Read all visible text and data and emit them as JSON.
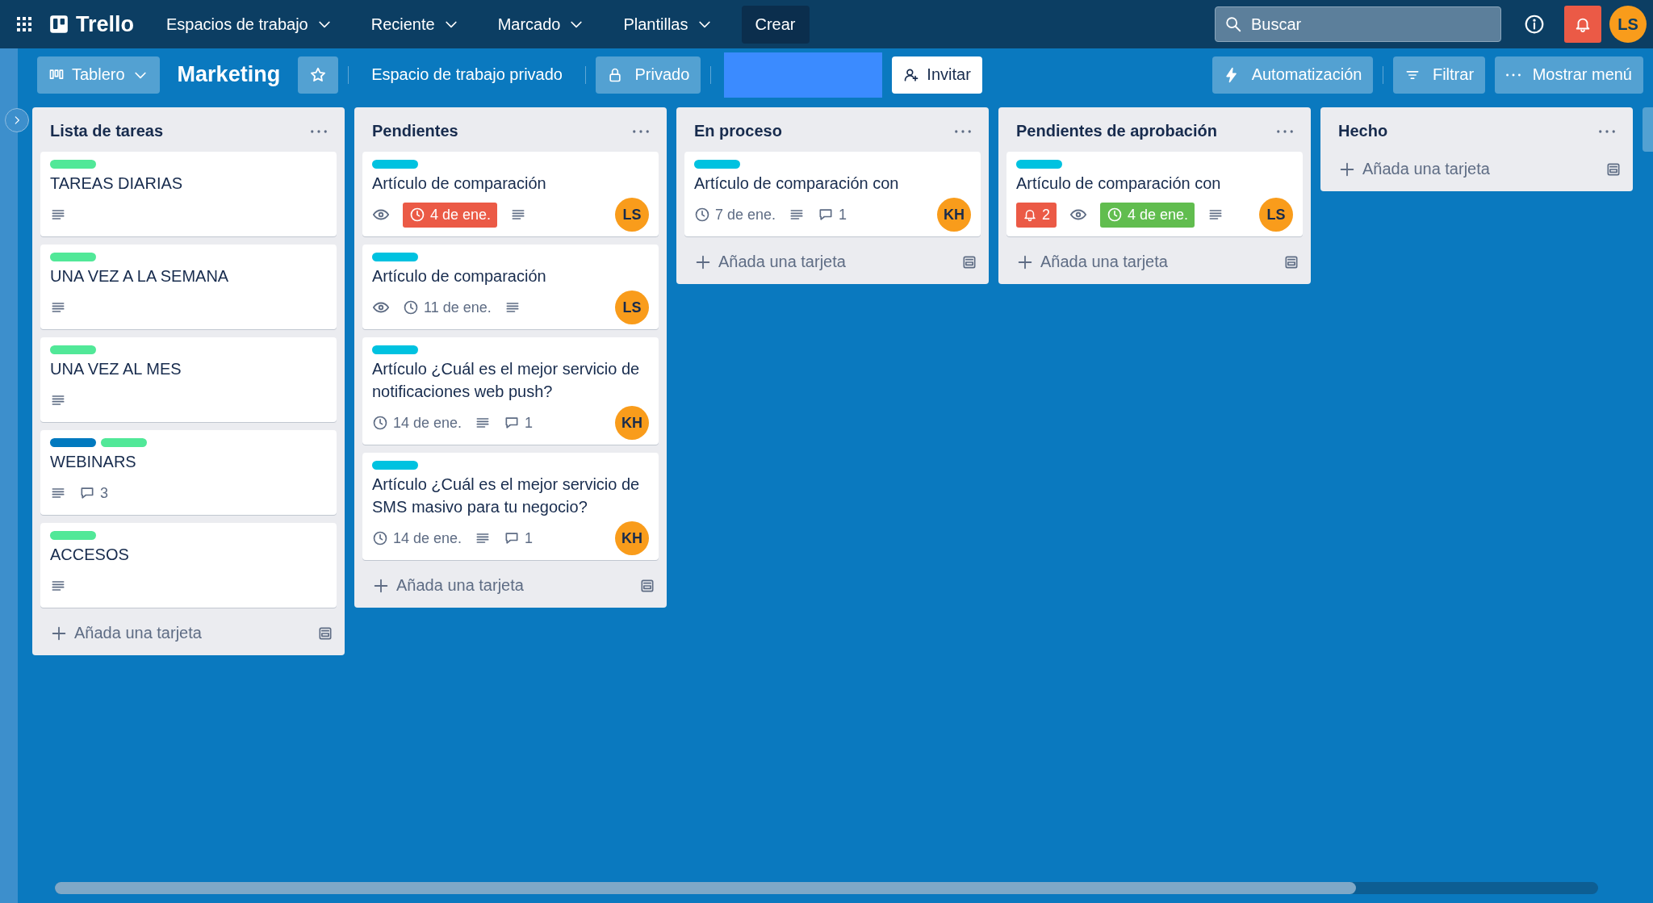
{
  "nav": {
    "app_name": "Trello",
    "menus": [
      {
        "label": "Espacios de trabajo"
      },
      {
        "label": "Reciente"
      },
      {
        "label": "Marcado"
      },
      {
        "label": "Plantillas"
      }
    ],
    "create": "Crear",
    "search": {
      "placeholder": "Buscar"
    },
    "avatar": "LS"
  },
  "board_bar": {
    "view": "Tablero",
    "title": "Marketing",
    "starred": false,
    "workspace": "Espacio de trabajo privado",
    "visibility": "Privado",
    "invite": "Invitar",
    "actions": [
      {
        "kind": "automation",
        "label": "Automatización"
      },
      {
        "kind": "filter",
        "label": "Filtrar"
      },
      {
        "kind": "menu",
        "label": "Mostrar menú"
      }
    ]
  },
  "lists": [
    {
      "title": "Lista de tareas",
      "add_card": "Añada una tarjeta",
      "cards": [
        {
          "labels": [
            {
              "color": "#51e898"
            }
          ],
          "title": "TAREAS DIARIAS",
          "badges": [
            {
              "kind": "description"
            }
          ]
        },
        {
          "labels": [
            {
              "color": "#51e898"
            }
          ],
          "title": "UNA VEZ A LA SEMANA",
          "badges": [
            {
              "kind": "description"
            }
          ]
        },
        {
          "labels": [
            {
              "color": "#51e898"
            }
          ],
          "title": "UNA VEZ AL MES",
          "badges": [
            {
              "kind": "description"
            }
          ]
        },
        {
          "labels": [
            {
              "color": "#0079bf"
            },
            {
              "color": "#51e898"
            }
          ],
          "title": "WEBINARS",
          "badges": [
            {
              "kind": "description"
            },
            {
              "kind": "comments",
              "text": "3"
            }
          ]
        },
        {
          "labels": [
            {
              "color": "#51e898"
            }
          ],
          "title": "ACCESOS",
          "badges": [
            {
              "kind": "description"
            }
          ]
        }
      ]
    },
    {
      "title": "Pendientes",
      "add_card": "Añada una tarjeta",
      "cards": [
        {
          "labels": [
            {
              "color": "#00c2e0"
            }
          ],
          "title": "Artículo de comparación",
          "badges": [
            {
              "kind": "watch"
            },
            {
              "kind": "due",
              "text": "4 de ene.",
              "overdue": true,
              "complete": false
            },
            {
              "kind": "description"
            }
          ],
          "member": "LS"
        },
        {
          "labels": [
            {
              "color": "#00c2e0"
            }
          ],
          "title": "Artículo de comparación",
          "badges": [
            {
              "kind": "watch"
            },
            {
              "kind": "due",
              "text": "11 de ene.",
              "overdue": false,
              "complete": false
            },
            {
              "kind": "description"
            }
          ],
          "member": "LS"
        },
        {
          "labels": [
            {
              "color": "#00c2e0"
            }
          ],
          "title": "Artículo ¿Cuál es el mejor servicio de notificaciones web push?",
          "badges": [
            {
              "kind": "due",
              "text": "14 de ene.",
              "overdue": false,
              "complete": false
            },
            {
              "kind": "description"
            },
            {
              "kind": "comments",
              "text": "1"
            }
          ],
          "member": "KH"
        },
        {
          "labels": [
            {
              "color": "#00c2e0"
            }
          ],
          "title": "Artículo ¿Cuál es el mejor servicio de SMS masivo para tu negocio?",
          "badges": [
            {
              "kind": "due",
              "text": "14 de ene.",
              "overdue": false,
              "complete": false
            },
            {
              "kind": "description"
            },
            {
              "kind": "comments",
              "text": "1"
            }
          ],
          "member": "KH"
        }
      ]
    },
    {
      "title": "En proceso",
      "add_card": "Añada una tarjeta",
      "cards": [
        {
          "labels": [
            {
              "color": "#00c2e0"
            }
          ],
          "title": "Artículo de comparación con",
          "badges": [
            {
              "kind": "due",
              "text": "7 de ene.",
              "overdue": false,
              "complete": false
            },
            {
              "kind": "description"
            },
            {
              "kind": "comments",
              "text": "1"
            }
          ],
          "member": "KH"
        }
      ]
    },
    {
      "title": "Pendientes de aprobación",
      "add_card": "Añada una tarjeta",
      "cards": [
        {
          "labels": [
            {
              "color": "#00c2e0"
            }
          ],
          "title": "Artículo de comparación con",
          "badges": [
            {
              "kind": "notifications",
              "text": "2"
            },
            {
              "kind": "watch"
            },
            {
              "kind": "due",
              "text": "4 de ene.",
              "overdue": false,
              "complete": true
            },
            {
              "kind": "description"
            }
          ],
          "member": "LS"
        }
      ]
    },
    {
      "title": "Hecho",
      "add_card": "Añada una tarjeta"
    }
  ]
}
